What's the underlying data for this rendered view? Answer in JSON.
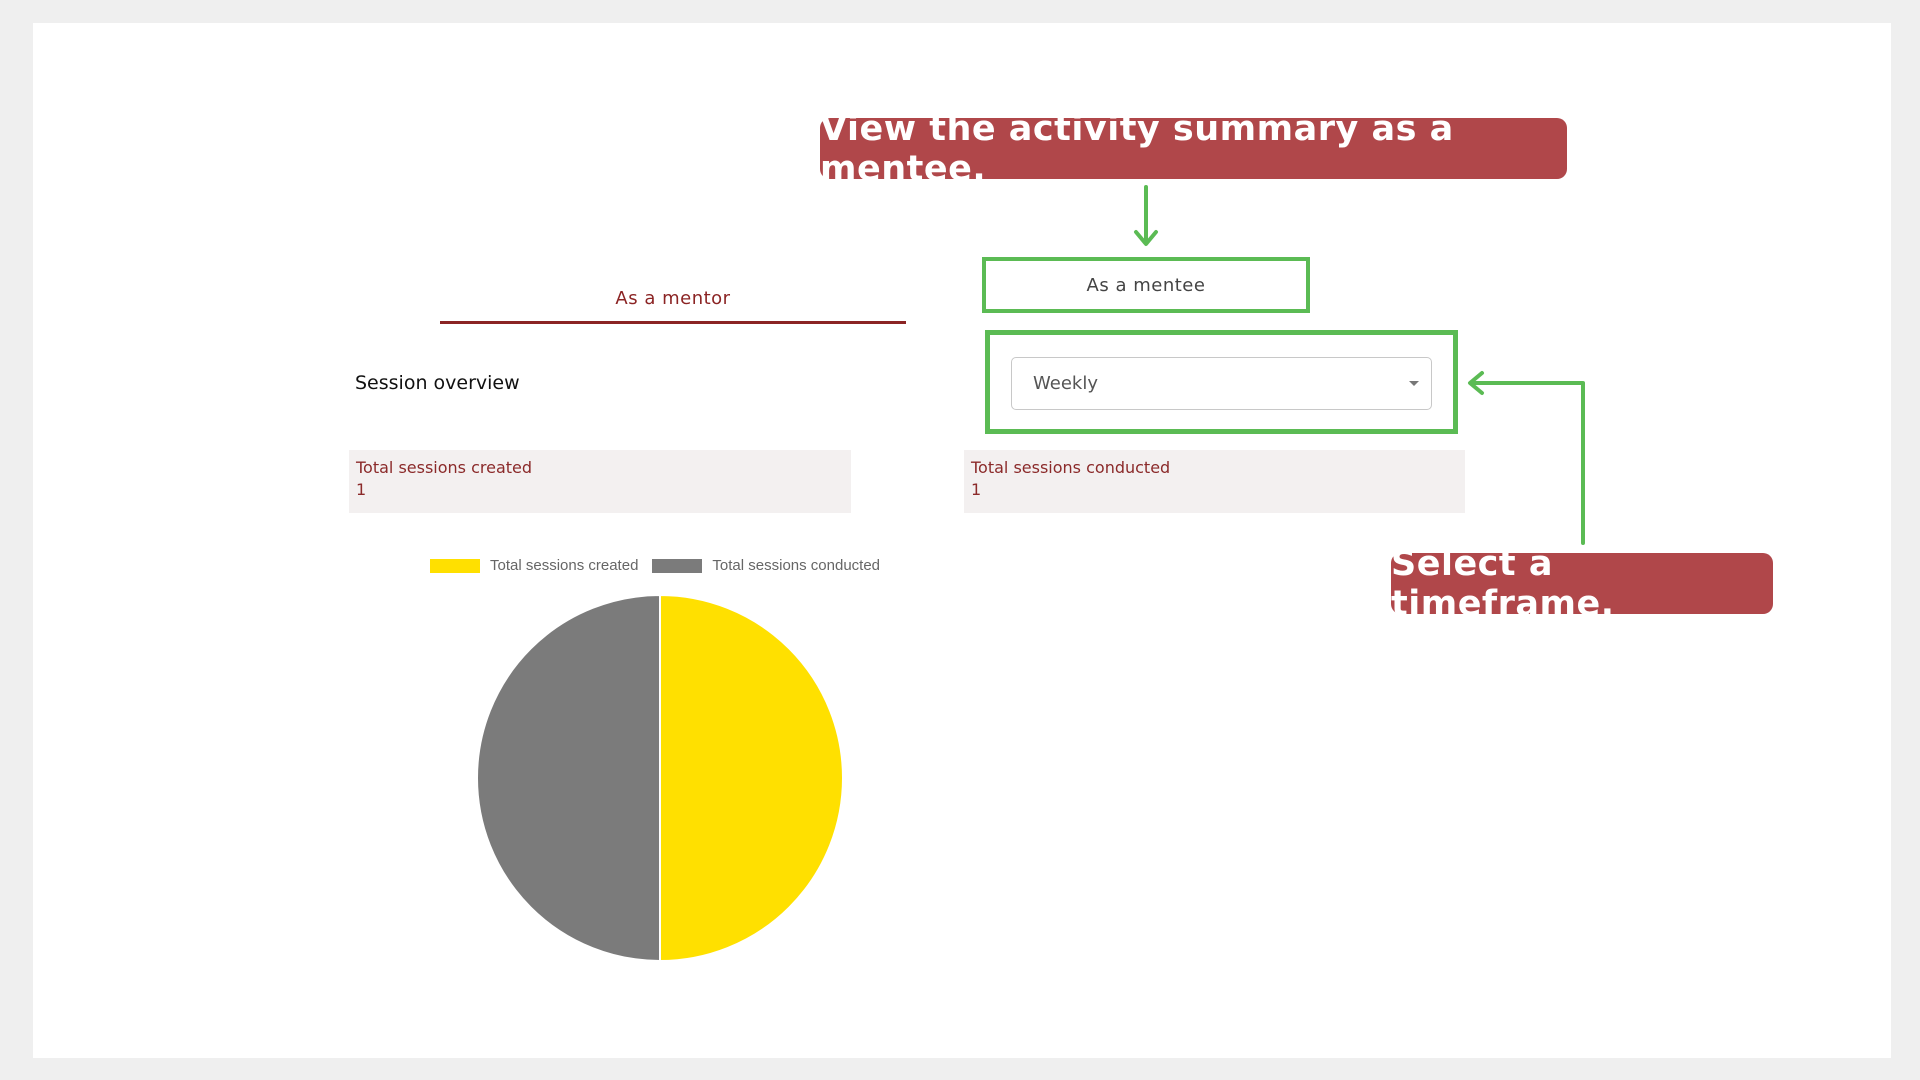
{
  "tabs": {
    "mentor_label": "As a mentor",
    "mentee_label": "As a mentee"
  },
  "section": {
    "title": "Session overview"
  },
  "timeframe": {
    "selected": "Weekly"
  },
  "stats": {
    "created": {
      "label": "Total sessions created",
      "value": "1"
    },
    "conducted": {
      "label": "Total sessions conducted",
      "value": "1"
    }
  },
  "chart_data": {
    "type": "pie",
    "categories": [
      "Total sessions created",
      "Total sessions conducted"
    ],
    "values": [
      1,
      1
    ],
    "colors": [
      "#ffe000",
      "#7b7b7b"
    ],
    "legend": "top"
  },
  "callouts": {
    "mentee": "View the activity summary as a mentee.",
    "timeframe": "Select a timeframe."
  },
  "colors": {
    "accent": "#8b2424",
    "highlight": "#5bbb54",
    "callout_bg": "#b0474a"
  }
}
